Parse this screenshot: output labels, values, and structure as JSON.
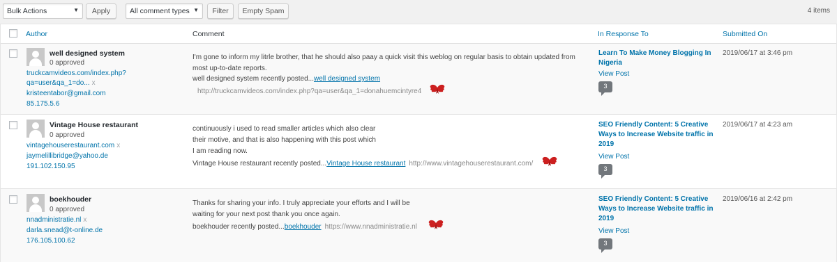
{
  "toolbar": {
    "bulk_actions": "Bulk Actions",
    "apply": "Apply",
    "comment_types": "All comment types",
    "filter": "Filter",
    "empty_spam": "Empty Spam",
    "items_count": "4 items"
  },
  "columns": {
    "author": "Author",
    "comment": "Comment",
    "in_response_to": "In Response To",
    "submitted_on": "Submitted On"
  },
  "rows": [
    {
      "author_name": "well designed system",
      "approved": "0 approved",
      "url_line1": "truckcamvideos.com/index.php?",
      "url_line2": "qa=user&qa_1=do...",
      "x": "x",
      "email": "kristeentabor@gmail.com",
      "ip": "85.175.5.6",
      "comment_lines": [
        "I'm gone to inform my litrle brother, that he should also paay a quick visit this weblog on regular basis to obtain updated from",
        "most up-to-date reports."
      ],
      "posted_prefix": "well designed system recently posted...",
      "posted_link": "well designed system",
      "posted_url": "http://truckcamvideos.com/index.php?qa=user&qa_1=donahuemcintyre4",
      "response_title": "Learn To Make Money Blogging In Nigeria",
      "view_post": "View Post",
      "count": "3",
      "date": "2019/06/17 at 3:46 pm"
    },
    {
      "author_name": "Vintage House restaurant",
      "approved": "0 approved",
      "url_line1": "vintagehouserestaurant.com",
      "x": "x",
      "email": "jaymelillibridge@yahoo.de",
      "ip": "191.102.150.95",
      "comment_lines": [
        "continuously i used to read smaller articles which also clear",
        "their motive, and that is also happening with this post which",
        "I am reading now."
      ],
      "posted_prefix": "Vintage House restaurant recently posted...",
      "posted_link": "Vintage House restaurant",
      "posted_url": "http://www.vintagehouserestaurant.com/",
      "response_title": "SEO Friendly Content: 5 Creative Ways to Increase Website traffic in 2019",
      "view_post": "View Post",
      "count": "3",
      "date": "2019/06/17 at 4:23 am"
    },
    {
      "author_name": "boekhouder",
      "approved": "0 approved",
      "url_line1": "nnadministratie.nl",
      "x": "x",
      "email": "darla.snead@t-online.de",
      "ip": "176.105.100.62",
      "comment_lines": [
        "Thanks for sharing your info. I truly appreciate your efforts and I will be",
        "waiting for your next post thank you once again."
      ],
      "posted_prefix": "boekhouder recently posted...",
      "posted_link": "boekhouder",
      "posted_url": "https://www.nnadministratie.nl",
      "response_title": "SEO Friendly Content: 5 Creative Ways to Increase Website traffic in 2019",
      "view_post": "View Post",
      "count": "3",
      "date": "2019/06/16 at 2:42 pm"
    }
  ],
  "colors": {
    "link": "#0073aa",
    "heart": "#cc1f1f",
    "bubble": "#72777c"
  },
  "icons": {
    "select_caret": "caret-down-icon",
    "avatar": "default-avatar-icon",
    "commentluv": "heart-wings-icon",
    "comment_count": "speech-bubble-icon"
  }
}
